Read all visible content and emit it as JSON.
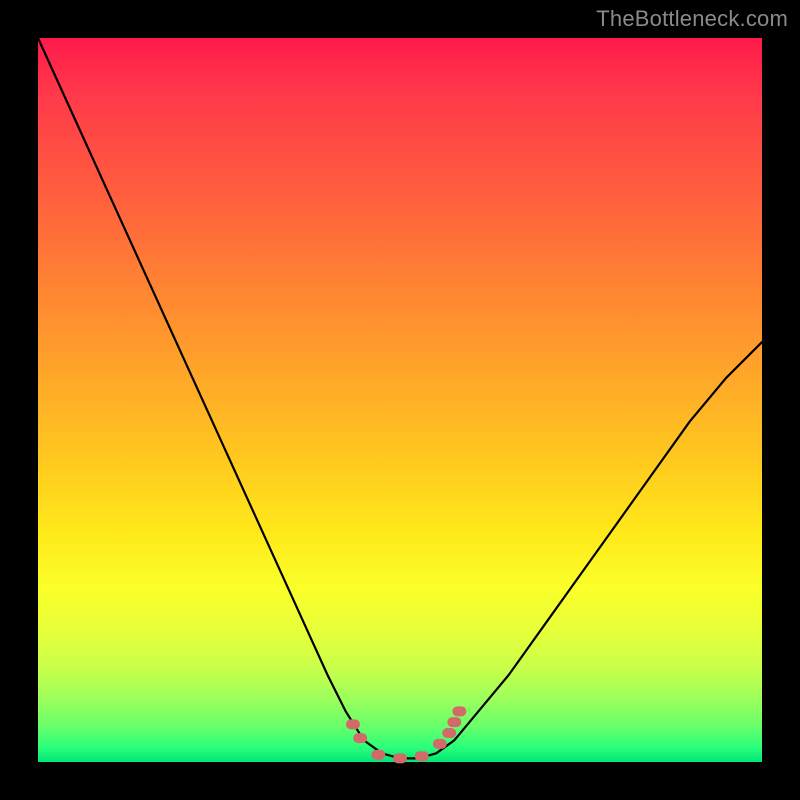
{
  "watermark": "TheBottleneck.com",
  "colors": {
    "background": "#000000",
    "curve": "#000000",
    "marker": "#d36a6a"
  },
  "chart_data": {
    "type": "line",
    "title": "",
    "xlabel": "",
    "ylabel": "",
    "xlim": [
      0,
      1
    ],
    "ylim": [
      0,
      1
    ],
    "grid": false,
    "legend": false,
    "series": [
      {
        "name": "bottleneck-curve",
        "x": [
          0.0,
          0.05,
          0.1,
          0.15,
          0.2,
          0.25,
          0.3,
          0.35,
          0.4,
          0.425,
          0.45,
          0.475,
          0.5,
          0.525,
          0.55,
          0.575,
          0.6,
          0.65,
          0.7,
          0.75,
          0.8,
          0.85,
          0.9,
          0.95,
          1.0
        ],
        "y": [
          1.0,
          0.89,
          0.78,
          0.67,
          0.56,
          0.45,
          0.34,
          0.23,
          0.12,
          0.07,
          0.03,
          0.012,
          0.005,
          0.005,
          0.012,
          0.03,
          0.06,
          0.12,
          0.19,
          0.26,
          0.33,
          0.4,
          0.47,
          0.53,
          0.58
        ]
      }
    ],
    "markers": {
      "name": "highlight-points",
      "x": [
        0.435,
        0.445,
        0.47,
        0.5,
        0.53,
        0.555,
        0.568,
        0.575,
        0.582
      ],
      "y": [
        0.052,
        0.033,
        0.01,
        0.005,
        0.008,
        0.025,
        0.04,
        0.055,
        0.07
      ]
    }
  }
}
